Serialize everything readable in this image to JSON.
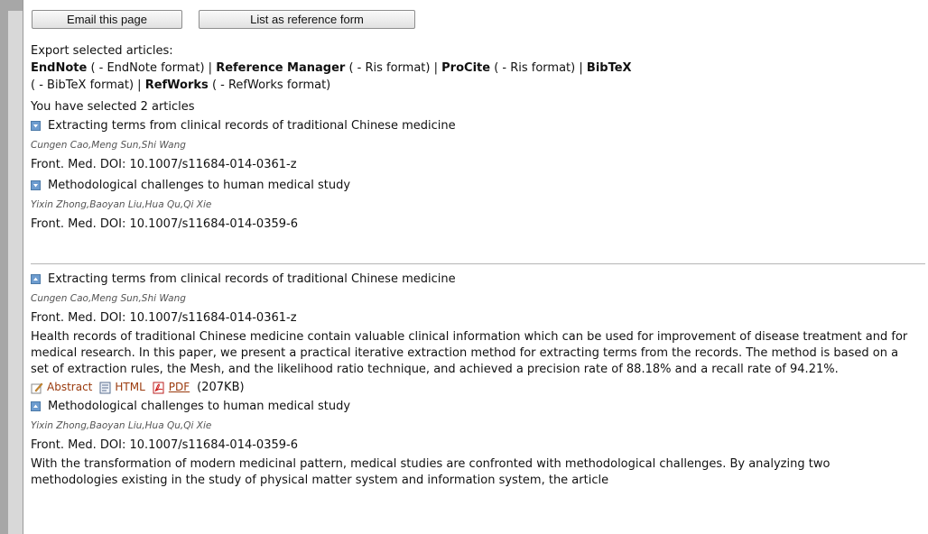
{
  "buttons": {
    "email": "Email this page",
    "reference": "List as reference form"
  },
  "export": {
    "heading": "Export selected articles:",
    "formats": [
      {
        "name": "EndNote",
        "desc": "( - EndNote format)"
      },
      {
        "name": "Reference Manager",
        "desc": "( - Ris format)"
      },
      {
        "name": "ProCite",
        "desc": "( - Ris format)"
      },
      {
        "name": "BibTeX",
        "desc": "( - BibTeX format)"
      },
      {
        "name": "RefWorks",
        "desc": "( - RefWorks format)"
      }
    ],
    "separator": "|"
  },
  "selected_text": "You have selected 2 articles",
  "selected": [
    {
      "title": "Extracting terms from clinical records of traditional Chinese medicine",
      "authors": "Cungen Cao,Meng Sun,Shi Wang",
      "doi": "Front. Med. DOI: 10.1007/s11684-014-0361-z"
    },
    {
      "title": "Methodological challenges to human medical study",
      "authors": "Yixin Zhong,Baoyan Liu,Hua Qu,Qi Xie",
      "doi": "Front. Med. DOI: 10.1007/s11684-014-0359-6"
    }
  ],
  "articles": [
    {
      "title": "Extracting terms from clinical records of traditional Chinese medicine",
      "authors": "Cungen Cao,Meng Sun,Shi Wang",
      "doi": "Front. Med. DOI: 10.1007/s11684-014-0361-z",
      "abstract": "Health records of traditional Chinese medicine contain valuable clinical information which can be used for improvement of disease treatment and for medical research. In this paper, we present a practical iterative extraction method for extracting terms from the records. The method is based on a set of extraction rules, the Mesh, and the likelihood ratio technique, and achieved a precision rate of 88.18% and a recall rate of 94.21%.",
      "links": {
        "abstract": "Abstract",
        "html": "HTML",
        "pdf": "PDF",
        "size": "(207KB)"
      }
    },
    {
      "title": "Methodological challenges to human medical study",
      "authors": "Yixin Zhong,Baoyan Liu,Hua Qu,Qi Xie",
      "doi": "Front. Med. DOI: 10.1007/s11684-014-0359-6",
      "abstract": "With the transformation of modern medicinal pattern, medical studies are confronted with methodological challenges. By analyzing two methodologies existing in the study of physical matter system and information system, the article"
    }
  ],
  "colors": {
    "link": "#9a3a0d",
    "icon": "#6d9ccf"
  }
}
